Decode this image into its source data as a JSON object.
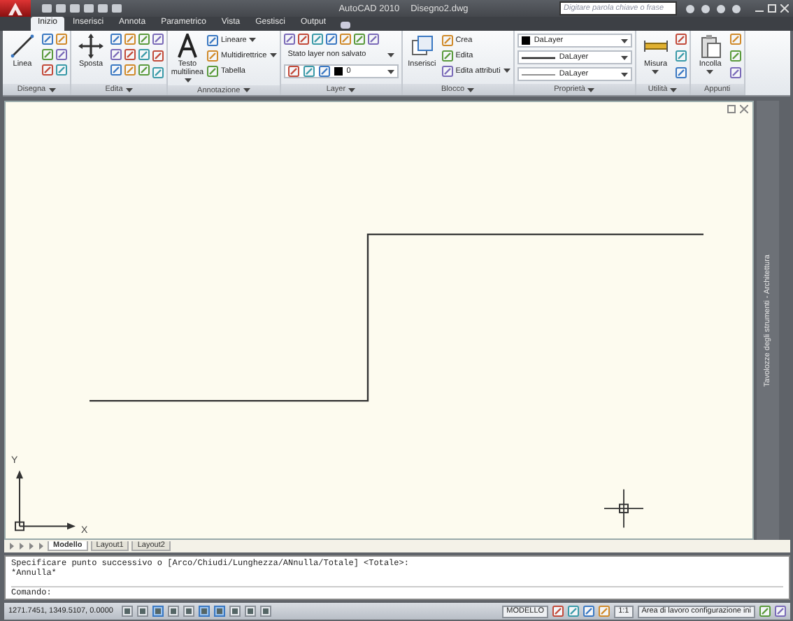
{
  "window": {
    "title": "AutoCAD 2010",
    "document": "Disegno2.dwg"
  },
  "search": {
    "placeholder": "Digitare parola chiave o frase"
  },
  "tabs": [
    {
      "label": "Inizio",
      "selected": true
    },
    {
      "label": "Inserisci",
      "selected": false
    },
    {
      "label": "Annota",
      "selected": false
    },
    {
      "label": "Parametrico",
      "selected": false
    },
    {
      "label": "Vista",
      "selected": false
    },
    {
      "label": "Gestisci",
      "selected": false
    },
    {
      "label": "Output",
      "selected": false
    }
  ],
  "ribbon": {
    "panels": [
      {
        "title": "Disegna",
        "menu": true,
        "columns": [
          [
            {
              "kind": "large",
              "label": "Linea",
              "menu": false
            }
          ],
          [
            {
              "kind": "tools"
            }
          ]
        ]
      },
      {
        "title": "Edita",
        "menu": true,
        "columns": [
          [
            {
              "kind": "large",
              "label": "Sposta",
              "menu": false
            }
          ],
          [
            {
              "kind": "tools"
            }
          ],
          [
            {
              "kind": "toolstack"
            }
          ]
        ]
      },
      {
        "title": "Annotazione",
        "menu": true,
        "columns": [
          [
            {
              "kind": "large",
              "label": "Testo multilinea",
              "menu": true
            }
          ],
          [
            {
              "kind": "small",
              "label": "Lineare",
              "menu": true
            },
            {
              "kind": "small",
              "label": "Multidirettrice",
              "menu": true
            },
            {
              "kind": "small",
              "label": "Tabella",
              "menu": false
            }
          ]
        ]
      },
      {
        "title": "Layer",
        "menu": true,
        "columns": [
          [
            {
              "kind": "toolrow"
            },
            {
              "kind": "dropdown",
              "value": "Stato layer non salvato"
            },
            {
              "kind": "layer-dropdown",
              "value": "0"
            }
          ]
        ]
      },
      {
        "title": "Blocco",
        "menu": true,
        "columns": [
          [
            {
              "kind": "large",
              "label": "Inserisci",
              "menu": false
            }
          ],
          [
            {
              "kind": "small",
              "label": "Crea",
              "menu": false
            },
            {
              "kind": "small",
              "label": "Edita",
              "menu": false
            },
            {
              "kind": "small",
              "label": "Edita attributi",
              "menu": true
            }
          ]
        ]
      },
      {
        "title": "Proprietà",
        "menu": true,
        "columns": [
          [
            {
              "kind": "color-dropdown",
              "value": "DaLayer"
            },
            {
              "kind": "linetype-dropdown",
              "value": "DaLayer"
            },
            {
              "kind": "lineweight-dropdown",
              "value": "DaLayer"
            }
          ]
        ]
      },
      {
        "title": "Utilità",
        "menu": true,
        "columns": [
          [
            {
              "kind": "large",
              "label": "Misura",
              "menu": true
            }
          ],
          [
            {
              "kind": "toolstack"
            }
          ]
        ]
      },
      {
        "title": "Appunti",
        "menu": false,
        "columns": [
          [
            {
              "kind": "large",
              "label": "Incolla",
              "menu": true
            }
          ],
          [
            {
              "kind": "toolstack"
            }
          ]
        ]
      }
    ]
  },
  "canvas": {
    "axis_x": "X",
    "axis_y": "Y"
  },
  "palette": {
    "title": "Tavolozze degli strumenti - Architettura"
  },
  "layout_tabs": [
    {
      "label": "Modello",
      "selected": true
    },
    {
      "label": "Layout1",
      "selected": false
    },
    {
      "label": "Layout2",
      "selected": false
    }
  ],
  "command": {
    "history": [
      "Specificare punto successivo o [Arco/Chiudi/Lunghezza/ANnulla/Totale] <Totale>:",
      "*Annulla*"
    ],
    "prompt": "Comando:"
  },
  "status_bar": {
    "coordinates": "1271.7451, 1349.5107, 0.0000",
    "toggles": [
      {
        "on": false
      },
      {
        "on": false
      },
      {
        "on": true
      },
      {
        "on": false
      },
      {
        "on": false
      },
      {
        "on": true
      },
      {
        "on": true
      },
      {
        "on": false
      },
      {
        "on": false
      },
      {
        "on": false
      }
    ],
    "space": "MODELLO",
    "scale": "1:1",
    "workspace": "Area di lavoro configurazione ini"
  }
}
